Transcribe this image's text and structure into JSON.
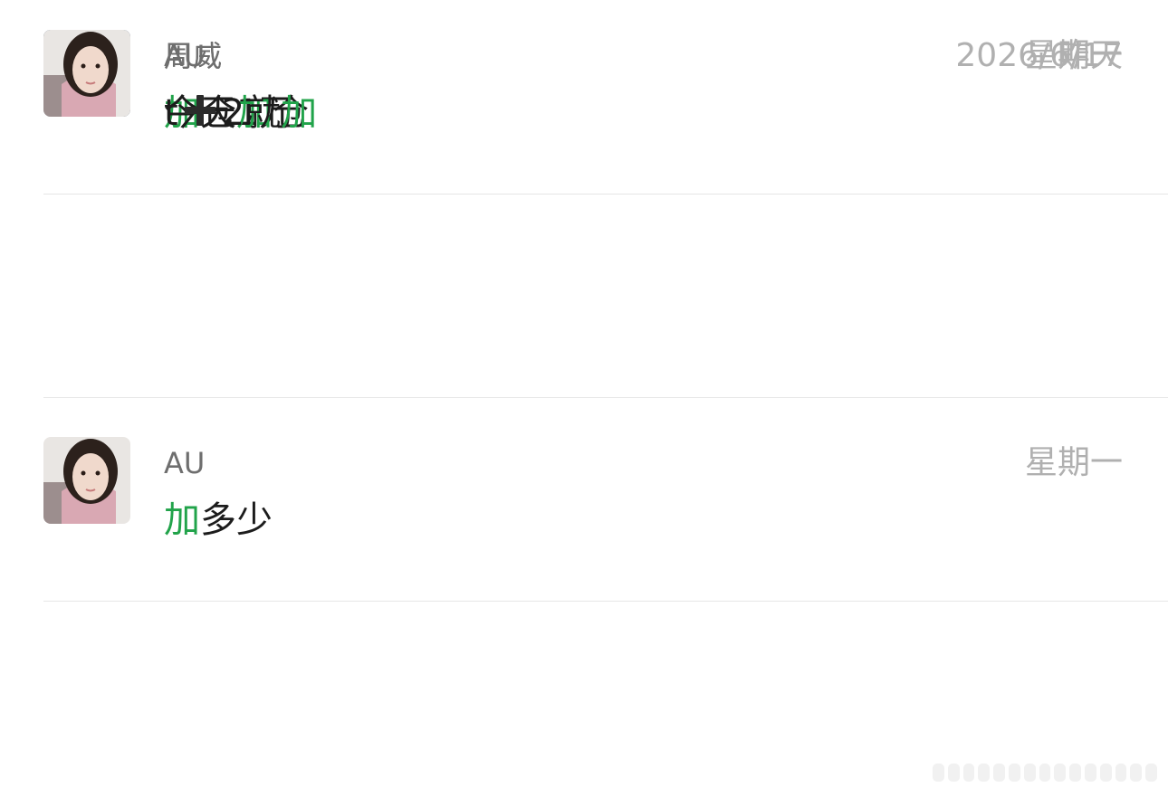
{
  "chats": [
    {
      "avatar": "man-photo-avatar",
      "name": "周威",
      "time": "昨天",
      "message": {
        "pre": "",
        "hl": "加",
        "post": "仓1万"
      }
    },
    {
      "avatar": "woman-photo-avatar",
      "name": "AU",
      "time": "星期一",
      "message": {
        "pre": "",
        "hl": "加",
        "post": "多少"
      }
    },
    {
      "avatar": "man-photo-avatar",
      "name": "周威",
      "time": "星期一",
      "message": {
        "pre": "今天",
        "hl": "加",
        "post": "仓"
      }
    },
    {
      "avatar": "woman-photo-avatar",
      "name": "AU",
      "time": "2026/6/17",
      "message": {
        "pre1": "t",
        "icon": "plus-icon",
        "pre2": "2就",
        "hl": "加",
        "post": ""
      }
    }
  ],
  "colors": {
    "highlight": "#21a34a",
    "name": "#6e6e6e",
    "time": "#b0b0b0",
    "message": "#1c1c1c",
    "divider": "#e6e6e6"
  }
}
